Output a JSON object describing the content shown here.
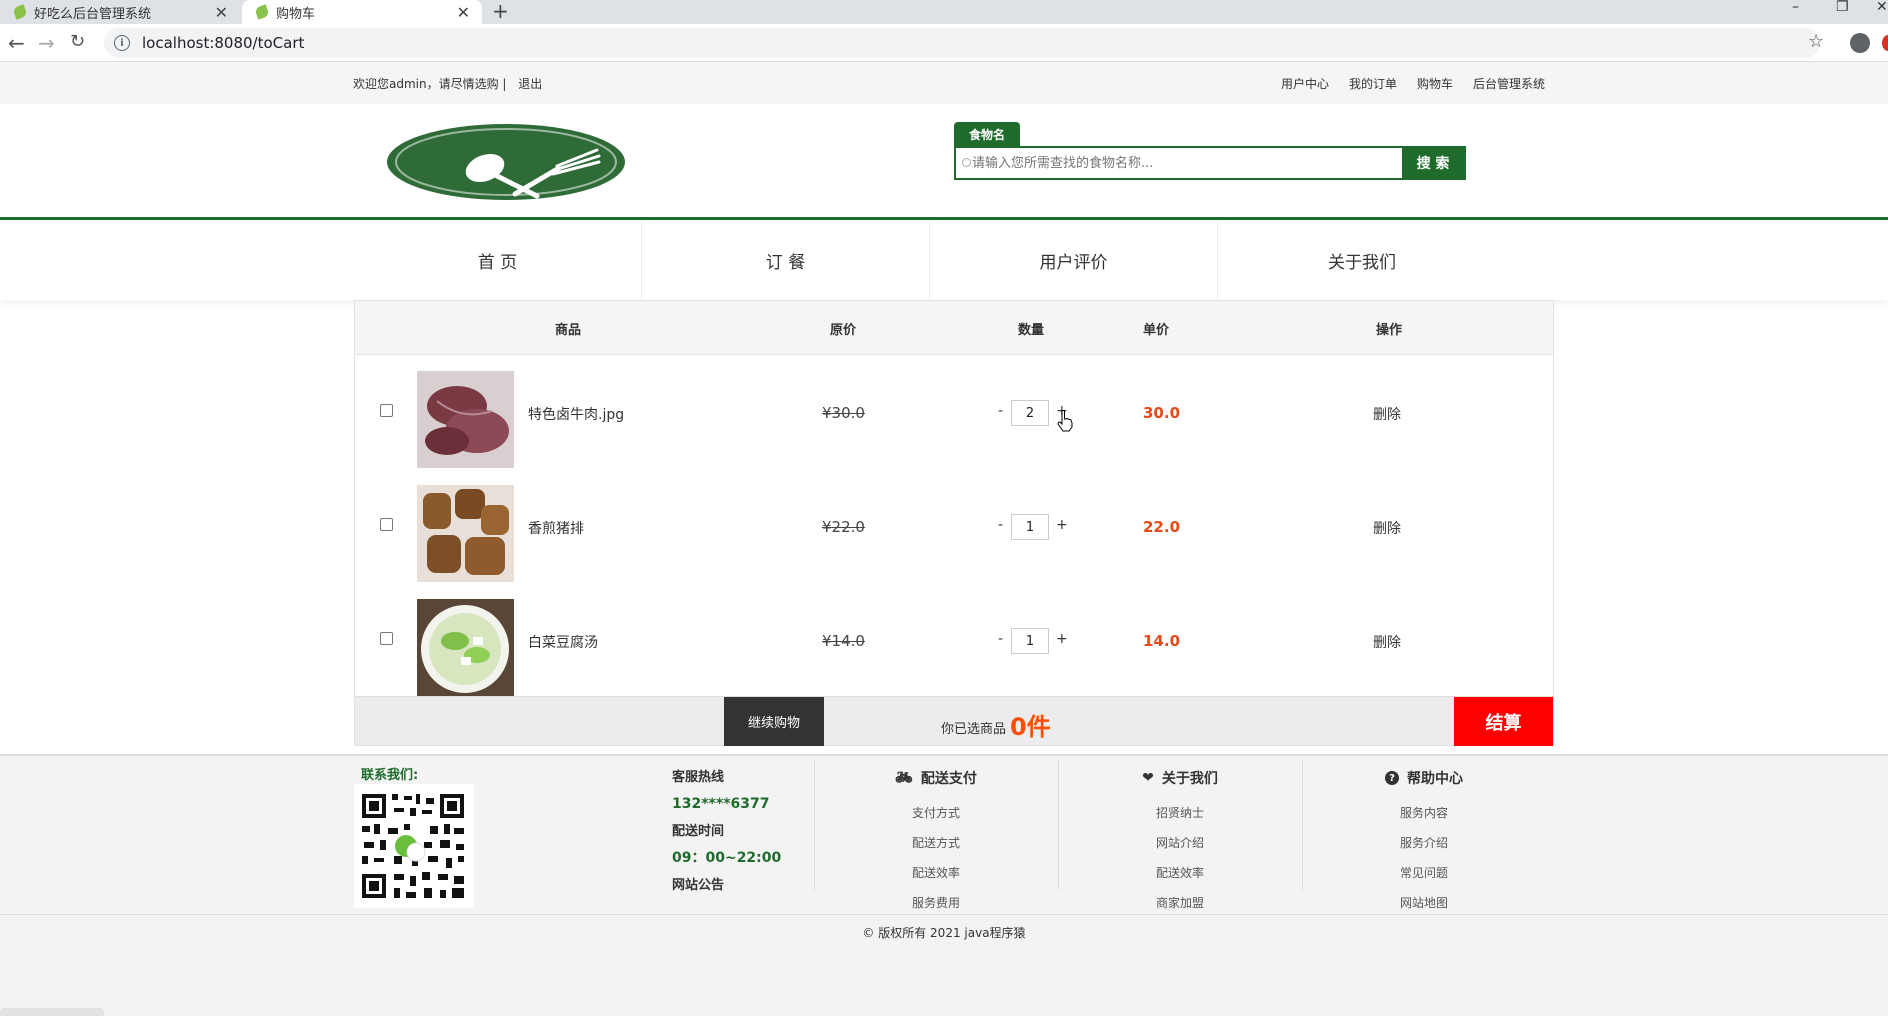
{
  "browser": {
    "tabs": [
      {
        "title": "好吃么后台管理系统"
      },
      {
        "title": "购物车"
      }
    ],
    "url": "localhost:8080/toCart"
  },
  "topbar": {
    "welcome": "欢迎您admin，请尽情选购 |",
    "logout": "退出",
    "links": [
      "用户中心",
      "我的订单",
      "购物车",
      "后台管理系统"
    ]
  },
  "search": {
    "tab_label": "食物名",
    "placeholder": "请输入您所需查找的食物名称...",
    "button": "搜 索"
  },
  "nav": [
    "首 页",
    "订 餐",
    "用户评价",
    "关于我们"
  ],
  "cart": {
    "headers": {
      "product": "商品",
      "orig_price": "原价",
      "qty": "数量",
      "unit_price": "单价",
      "action": "操作"
    },
    "items": [
      {
        "name": "特色卤牛肉.jpg",
        "orig_price": "¥30.0",
        "qty": "2",
        "unit_price": "30.0",
        "action": "删除"
      },
      {
        "name": "香煎猪排",
        "orig_price": "¥22.0",
        "qty": "1",
        "unit_price": "22.0",
        "action": "删除"
      },
      {
        "name": "白菜豆腐汤",
        "orig_price": "¥14.0",
        "qty": "1",
        "unit_price": "14.0",
        "action": "删除"
      }
    ],
    "minus": "-",
    "plus": "+",
    "continue_btn": "继续购物",
    "selected_prefix": "你已选商品",
    "selected_count": "0件",
    "checkout": "结算"
  },
  "footer": {
    "contact_title": "联系我们:",
    "hotline_label": "客服热线",
    "hotline_value": "132****6377",
    "hours_label": "配送时间",
    "hours_value": "09：00~22:00",
    "notice_label": "网站公告",
    "columns": [
      {
        "title": "配送支付",
        "icon": "bicycle-icon",
        "links": [
          "支付方式",
          "配送方式",
          "配送效率",
          "服务费用"
        ]
      },
      {
        "title": "关于我们",
        "icon": "heart-icon",
        "links": [
          "招贤纳士",
          "网站介绍",
          "配送效率",
          "商家加盟"
        ]
      },
      {
        "title": "帮助中心",
        "icon": "question-icon",
        "links": [
          "服务内容",
          "服务介绍",
          "常见问题",
          "网站地图"
        ]
      }
    ],
    "copyright": "© 版权所有 2021   java程序猿"
  },
  "colors": {
    "brand_green": "#1e6b2c",
    "price_orange": "#e64a19",
    "checkout_red": "#ff0000"
  }
}
